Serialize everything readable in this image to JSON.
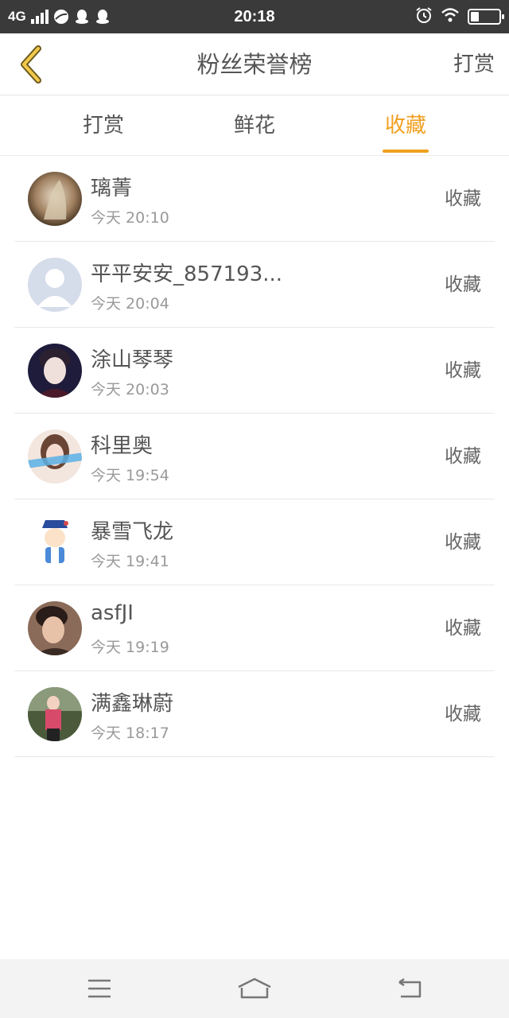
{
  "status_bar": {
    "network": "4G",
    "time": "20:18",
    "battery_level": 0.3
  },
  "nav": {
    "title": "粉丝荣誉榜",
    "right_action": "打赏",
    "back_icon": "chevron-left-icon"
  },
  "tabs": [
    {
      "label": "打赏",
      "active": false
    },
    {
      "label": "鲜花",
      "active": false
    },
    {
      "label": "收藏",
      "active": true
    }
  ],
  "colors": {
    "accent": "#f0a020",
    "status_bar": "#3a3a3a",
    "text": "#555555",
    "muted": "#999999"
  },
  "list": [
    {
      "name": "璃菁",
      "time": "今天 20:10",
      "action": "收藏",
      "avatar": "avatar-photo"
    },
    {
      "name": "平平安安_857193...",
      "time": "今天 20:04",
      "action": "收藏",
      "avatar": "default-avatar"
    },
    {
      "name": "涂山琴琴",
      "time": "今天 20:03",
      "action": "收藏",
      "avatar": "avatar-photo"
    },
    {
      "name": "科里奥",
      "time": "今天 19:54",
      "action": "收藏",
      "avatar": "avatar-photo"
    },
    {
      "name": "暴雪飞龙",
      "time": "今天 19:41",
      "action": "收藏",
      "avatar": "cartoon-avatar"
    },
    {
      "name": "asfJI",
      "time": "今天 19:19",
      "action": "收藏",
      "avatar": "avatar-photo"
    },
    {
      "name": "满鑫琳蔚",
      "time": "今天 18:17",
      "action": "收藏",
      "avatar": "avatar-photo"
    }
  ],
  "system_nav": [
    "menu-icon",
    "home-icon",
    "back-icon"
  ]
}
